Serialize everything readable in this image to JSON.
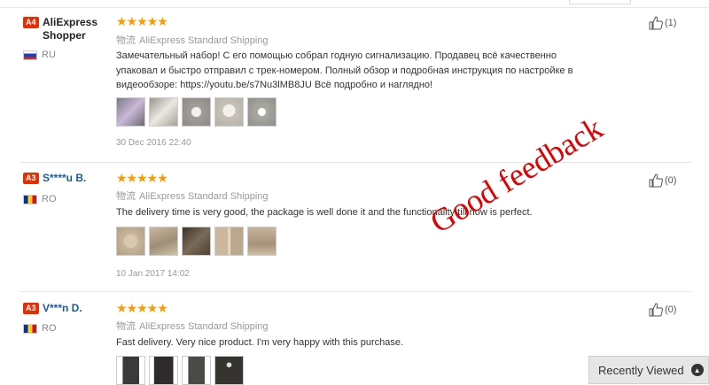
{
  "reviews": [
    {
      "level": "A4",
      "user": "AliExpress Shopper",
      "country": "RU",
      "stars": "★★★★★",
      "ship_cn": "物流",
      "shipping": "AliExpress Standard Shipping",
      "text": "Замечательный набор! С его помощью собрал годную сигнализацию. Продавец всё качественно упаковал и быстро отправил с трек-номером. Полный обзор и подробная инструкция по настройке в видеообзоре: https://youtu.be/s7Nu3lMB8JU Всё подробно и наглядно!",
      "date": "30 Dec 2016 22:40",
      "helpful": "(1)",
      "thumb_colors": [
        "#7c7a86",
        "#bdb7ad",
        "#a39e9a",
        "#c7c1b8",
        "#aaa9a2"
      ]
    },
    {
      "level": "A3",
      "user": "S****u B.",
      "country": "RO",
      "stars": "★★★★★",
      "ship_cn": "物流",
      "shipping": "AliExpress Standard Shipping",
      "text": "The delivery time is very good, the package is well done it and the functionality till now is perfect.",
      "date": "10 Jan 2017 14:02",
      "helpful": "(0)",
      "thumb_colors": [
        "#c9b59a",
        "#b29f87",
        "#5d5042",
        "#cbb79d",
        "#b9a690"
      ]
    },
    {
      "level": "A3",
      "user": "V***n D.",
      "country": "RO",
      "stars": "★★★★★",
      "ship_cn": "物流",
      "shipping": "AliExpress Standard Shipping",
      "text": "Fast delivery. Very nice product. I'm very happy with this purchase.",
      "helpful": "(0)",
      "thumb_colors": [
        "#3a3a3a",
        "#2e2b2a",
        "#4a4a46",
        "#35342f"
      ]
    }
  ],
  "overlay_text": "Good feedback",
  "recently_viewed": "Recently Viewed",
  "colors": {
    "badge": "#e62e04",
    "star": "#ff9900",
    "username": "#1a5a9e",
    "overlay": "#e00000"
  }
}
